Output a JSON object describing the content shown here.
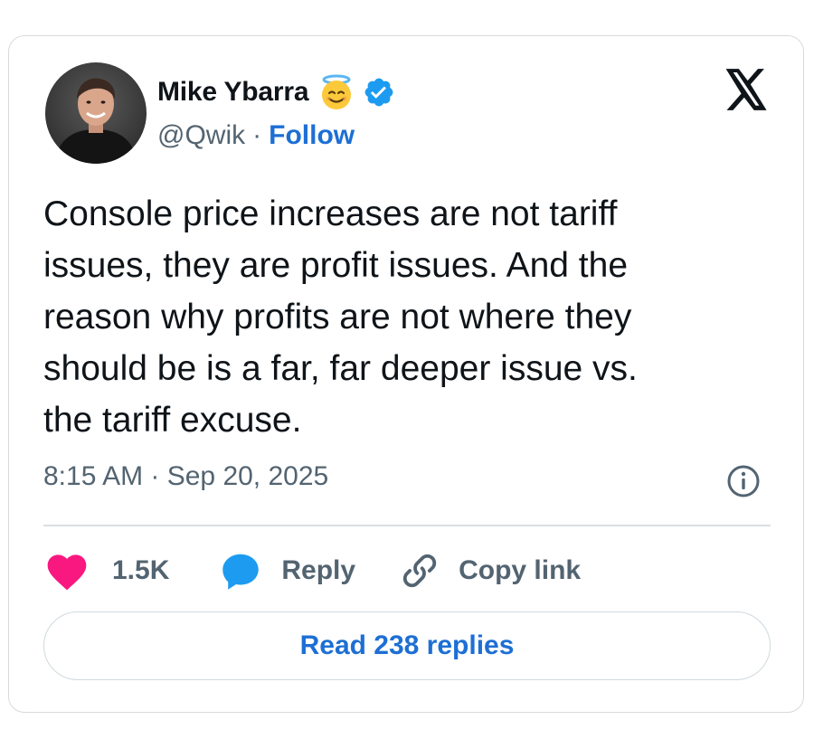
{
  "author": {
    "display_name": "Mike Ybarra",
    "handle": "@Qwik",
    "separator": "·",
    "follow_label": "Follow",
    "emoji": "smiling-face-with-halo",
    "verified": true
  },
  "tweet": {
    "text": "Console price increases are not tariff\nissues, they are profit issues. And the\nreason why profits are not where they\nshould be is a far, far deeper issue vs.\nthe tariff excuse.",
    "timestamp": "8:15 AM · Sep 20, 2025"
  },
  "actions": {
    "like_count": "1.5K",
    "reply_label": "Reply",
    "copy_link_label": "Copy link"
  },
  "footer": {
    "read_replies_label": "Read 238 replies"
  },
  "icons": {
    "brand": "x-logo-icon",
    "like": "heart-icon",
    "reply": "speech-bubble-icon",
    "copy": "link-icon",
    "info": "info-icon"
  },
  "colors": {
    "accent_blue": "#1d6fd4",
    "verified_blue": "#1d9bf0",
    "heart_pink": "#f91880",
    "reply_blue": "#1d9bf0",
    "muted_text": "#536471",
    "border": "#cfd9de"
  }
}
